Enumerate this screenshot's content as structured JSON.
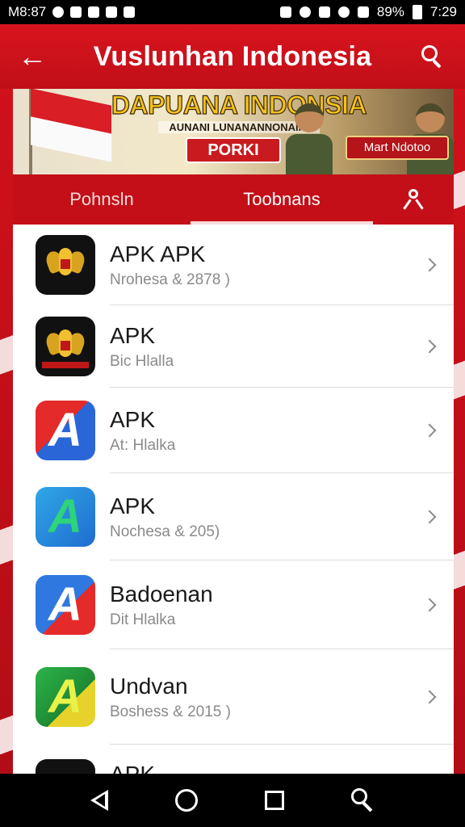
{
  "status_bar": {
    "left_text": "M8:87",
    "battery": "89%",
    "time": "7:29"
  },
  "header": {
    "title": "Vuslunhan Indonesia"
  },
  "banner": {
    "title": "DAPUANA INDONSIA",
    "subtitle": "AUNANI LUNANANNONAINI",
    "button_primary": "PORKI",
    "button_secondary": "Mart Ndotoo"
  },
  "tabs": [
    {
      "label": "Pohnsln"
    },
    {
      "label": "Toobnans"
    }
  ],
  "apps": [
    {
      "name": "APK APK",
      "subtitle": "Nrohesa & 2878 )",
      "icon": "garuda-icon"
    },
    {
      "name": "APK",
      "subtitle": "Bic Hlalla",
      "icon": "garuda-icon"
    },
    {
      "name": "APK",
      "subtitle": "At: Hlalka",
      "icon": "letter-a-icon"
    },
    {
      "name": "APK",
      "subtitle": "Nochesa & 205)",
      "icon": "letter-a-icon"
    },
    {
      "name": "Badoenan",
      "subtitle": "Dit Hlalka",
      "icon": "letter-a-icon"
    },
    {
      "name": "Undvan",
      "subtitle": "Boshess & 2015 )",
      "icon": "letter-a-icon"
    },
    {
      "name": "APK",
      "subtitle": "",
      "icon": "app-icon"
    }
  ],
  "colors": {
    "primary_red": "#c8101a",
    "status_bar": "#000000",
    "text_dark": "#1a1a1a",
    "text_muted": "#8a8a8a"
  }
}
